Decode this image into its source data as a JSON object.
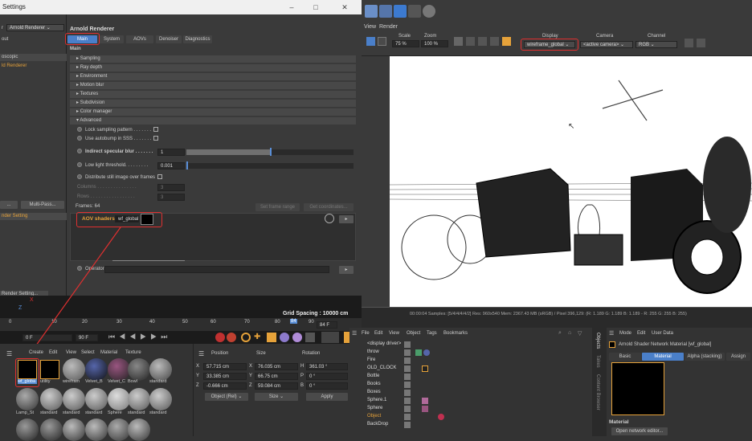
{
  "window": {
    "title": "Settings",
    "min": "–",
    "max": "□",
    "close": "✕"
  },
  "render_settings": {
    "renderer_label": "r",
    "renderer_value": "Arnold Renderer",
    "left_items": [
      "out",
      "oscopic",
      "ld Renderer"
    ],
    "multipass_btn": "Multi-Pass...",
    "left_dots": "...",
    "left_selected": "nder Setting",
    "footer": "Render Setting...",
    "header": "Arnold Renderer",
    "tabs": [
      "Main",
      "System",
      "AOVs",
      "Denoiser",
      "Diagnostics"
    ],
    "section": "Main",
    "groups": [
      "Sampling",
      "Ray depth",
      "Environment",
      "Motion blur",
      "Textures",
      "Subdivision",
      "Color manager"
    ],
    "group_open": "Advanced",
    "lock_sampling": "Lock sampling pattern . . . . . . .",
    "autobump": "Use autobump in SSS . . . . . . .",
    "ind_spec": "Indirect specular blur . . . . . . .",
    "ind_spec_val": "1",
    "low_light": "Low light threshold. . . . . . . . .",
    "low_light_val": "0.001",
    "distribute": "Distribute still image over frames",
    "columns": "Columns . . . . . . . . . . . . . . .",
    "columns_val": "3",
    "rows": "Rows . . . . . . . . . . . . . . . . .",
    "rows_val": "3",
    "frames": "Frames: 64",
    "set_frame": "Set frame range",
    "get_coords": "Get coordinates...",
    "aov_label": "AOV shaders",
    "aov_value": "wf_global",
    "operator": "Operator"
  },
  "viewport": {
    "menus": [
      "View",
      "Render"
    ],
    "scale_label": "Scale",
    "scale_val": "75 %",
    "zoom_label": "Zoom",
    "zoom_val": "100 %",
    "display_label": "Display",
    "display_val": "wireframe_global",
    "camera_label": "Camera",
    "camera_val": "<active camera>",
    "channel_label": "Channel",
    "channel_val": "RGB",
    "status": "00:00:04  Samples: [5/4/4/4/4/2]  Res: 960x540  Mem: 2367.43 MB  (sRGB) / Pixel 396,129: (R: 1.189 G: 1.189 B: 1.189 - R: 255 G: 255 B: 255)"
  },
  "timeline": {
    "ticks": [
      "0",
      "10",
      "20",
      "30",
      "40",
      "50",
      "60",
      "70",
      "80",
      "84",
      "90"
    ],
    "grid_spacing": "Grid Spacing : 10000 cm",
    "frame_start": "0 F",
    "frame_end": "90 F",
    "frame_current": "84 F",
    "axis_x": "X",
    "axis_z": "Z"
  },
  "materials": {
    "menus": [
      "Create",
      "Edit",
      "View",
      "Select",
      "Material",
      "Texture"
    ],
    "row1": [
      "wf_globa",
      "utility",
      "wirefram",
      "Velvet_B",
      "Velvet_C",
      "Bowl",
      "standard"
    ],
    "row2": [
      "Lamp_St",
      "standard",
      "standard",
      "standard",
      "Sphere",
      "standard",
      "standard"
    ]
  },
  "coords": {
    "headers": [
      "Position",
      "Size",
      "Rotation"
    ],
    "x": [
      "X",
      "57.715 cm",
      "X",
      "76.035 cm",
      "H",
      "361.03 °"
    ],
    "y": [
      "Y",
      "33.385 cm",
      "Y",
      "66.75 cm",
      "P",
      "0 °"
    ],
    "z": [
      "Z",
      "-0.666 cm",
      "Z",
      "59.084 cm",
      "B",
      "0 °"
    ],
    "mode": "Object (Rel)",
    "size_mode": "Size",
    "apply": "Apply"
  },
  "objects": {
    "menus": [
      "File",
      "Edit",
      "View",
      "Object",
      "Tags",
      "Bookmarks"
    ],
    "side_tabs": [
      "Objects",
      "Takes",
      "Content Browser"
    ],
    "items": [
      "<display driver>",
      "throw",
      "Fire",
      "OLD_CLOCK",
      "Bottle",
      "Books",
      "Boxes",
      "Sphere.1",
      "Sphere",
      "Object",
      "BackDrop"
    ]
  },
  "attributes": {
    "menus": [
      "Mode",
      "Edit",
      "User Data"
    ],
    "title": "Arnold Shader Network Material [wf_global]",
    "tabs": [
      "Basic",
      "Material",
      "Alpha (stacking)",
      "Assign"
    ],
    "section": "Material",
    "button": "Open network editor..."
  },
  "colors": {
    "accent": "#e03030",
    "selected": "#5a8fd8",
    "tab_active": "#4a7fc9"
  }
}
